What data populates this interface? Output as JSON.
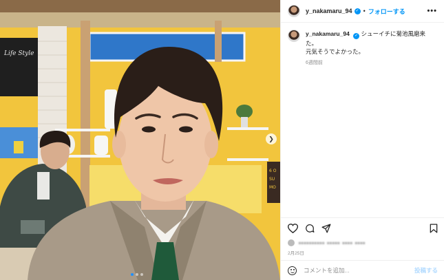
{
  "post": {
    "username": "y_nakamaru_94",
    "follow_label": "フォローする",
    "separator": "•",
    "more_label": "•••",
    "caption_line1": "シューイチに菊池風磨来た。",
    "caption_line2": "元気そうでよかった。",
    "time_ago": "6週間前",
    "likes_text": "•••••••••• ••••• •••• ••••",
    "date": "2月25日",
    "comment_placeholder": "コメントを追加...",
    "post_button": "投稿する"
  },
  "icons": {
    "verified": "verified-badge-icon",
    "more": "more-options-icon",
    "like": "heart-icon",
    "comment": "comment-icon",
    "share": "share-icon",
    "save": "bookmark-icon",
    "emoji": "emoji-icon",
    "carousel_next": "chevron-right-icon"
  },
  "colors": {
    "accent": "#0095f6",
    "muted": "#8e8e8e",
    "post_disabled": "#b3dbff"
  },
  "carousel": {
    "current": 1,
    "total": 3
  }
}
